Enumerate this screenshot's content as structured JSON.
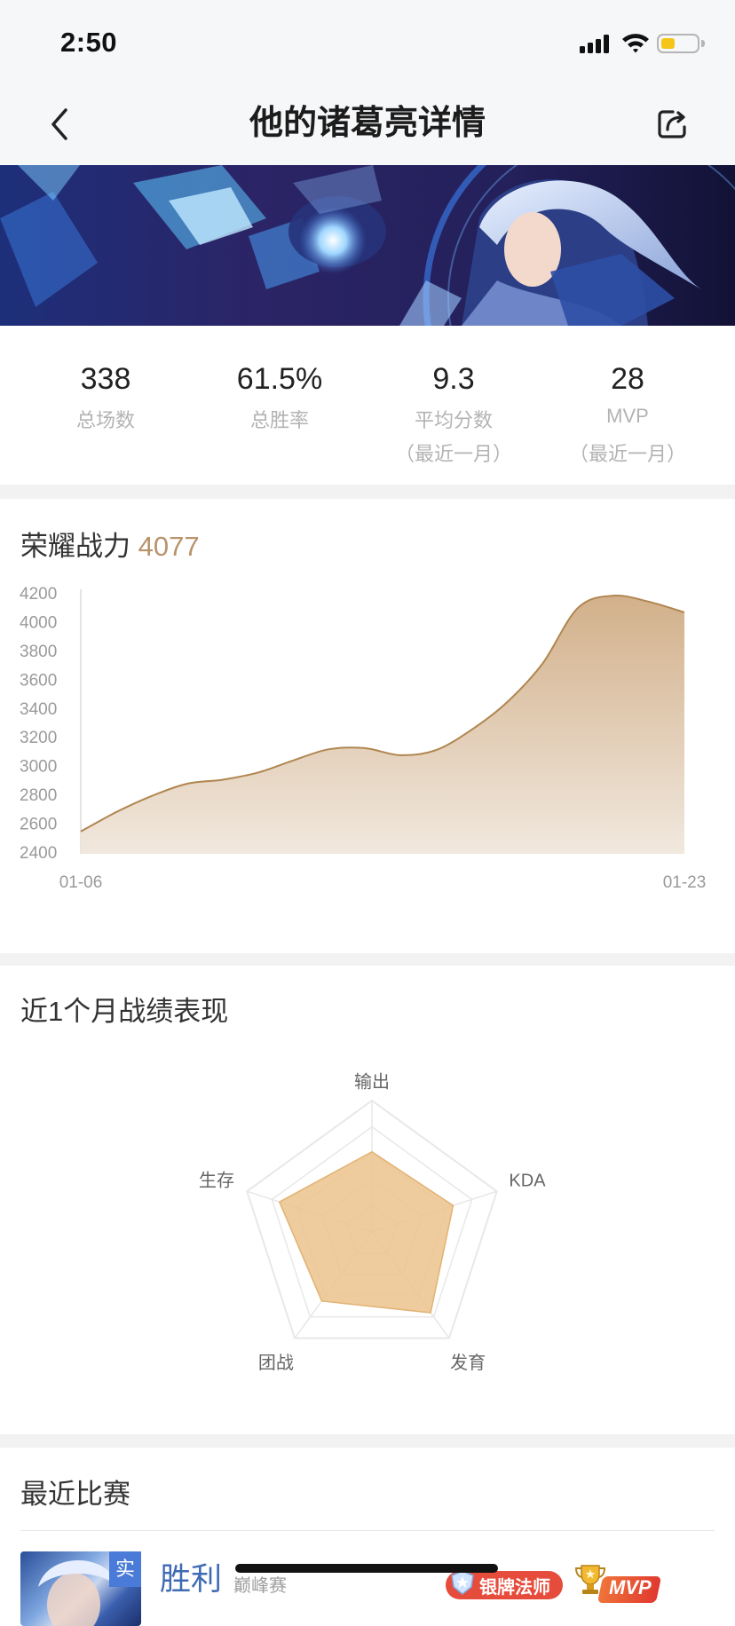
{
  "status_bar": {
    "time": "2:50",
    "icons": [
      "signal-icon",
      "wifi-icon",
      "battery-icon"
    ],
    "battery_level": 0.4
  },
  "nav": {
    "title": "他的诸葛亮详情",
    "back_icon": "chevron-left-icon",
    "share_icon": "share-icon"
  },
  "stats": [
    {
      "value": "338",
      "label": "总场数"
    },
    {
      "value": "61.5%",
      "label": "总胜率"
    },
    {
      "value": "9.3",
      "label": "平均分数",
      "sub": "（最近一月）"
    },
    {
      "value": "28",
      "label": "MVP",
      "sub": "（最近一月）"
    }
  ],
  "power": {
    "title": "荣耀战力",
    "value": "4077"
  },
  "performance": {
    "title": "近1个月战绩表现"
  },
  "recent": {
    "title": "最近比赛",
    "matches": [
      {
        "badge": "实",
        "result": "胜利",
        "mode": "巅峰赛",
        "tags": [
          "银牌法师",
          "MVP"
        ]
      }
    ]
  },
  "colors": {
    "accent_gold": "#b8936b",
    "area_top": "#d2b08a",
    "area_bottom": "#f1e8de",
    "line": "#b08650",
    "radar_fill": "#ecc38d",
    "win_blue": "#3f6bb3",
    "tag_red": "#e64c3c"
  },
  "chart_data": [
    {
      "type": "area",
      "xticks": [
        "01-06",
        "01-23"
      ],
      "yticks": [
        4200,
        4000,
        3800,
        3600,
        3400,
        3200,
        3000,
        2800,
        2600,
        2400
      ],
      "ylim": [
        2400,
        4200
      ],
      "grid": false,
      "series": [
        {
          "values": [
            2555,
            2690,
            2802,
            2887,
            2915,
            2965,
            3050,
            3127,
            3134,
            3085,
            3120,
            3261,
            3452,
            3720,
            4108,
            4193,
            4151,
            4077
          ]
        }
      ]
    },
    {
      "type": "radar",
      "axes": [
        "输出",
        "KDA",
        "发育",
        "团战",
        "生存"
      ],
      "values": [
        61,
        65,
        76,
        65,
        74
      ],
      "max": 100,
      "rings": 5
    }
  ]
}
